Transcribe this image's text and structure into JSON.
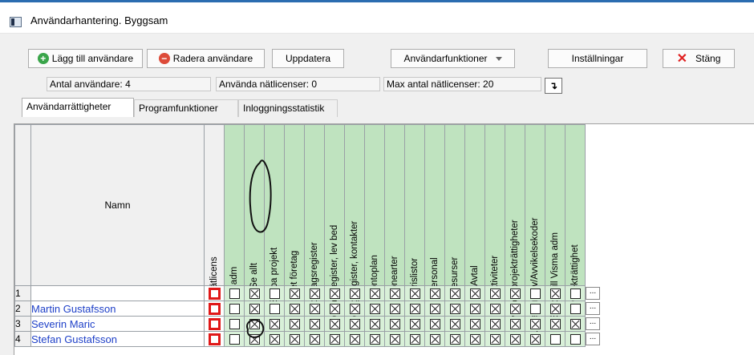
{
  "window": {
    "title": "Användarhantering. Byggsam"
  },
  "toolbar": {
    "add_user": "Lägg till användare",
    "delete_user": "Radera användare",
    "update": "Uppdatera",
    "user_functions": "Användarfunktioner",
    "settings": "Inställningar",
    "close": "Stäng"
  },
  "status": {
    "user_count": "Antal användare: 4",
    "used_licenses": "Använda nätlicenser: 0",
    "max_licenses": "Max antal nätlicenser: 20"
  },
  "tabs": [
    "Användarrättigheter",
    "Programfunktioner",
    "Inloggningsstatistik"
  ],
  "grid": {
    "name_header": "Namn",
    "columns": [
      "Nätlicens",
      "adm",
      "Se allt",
      "Skapa projekt",
      "Eget företag",
      "Företagsregister",
      "Företagsregister, lev bed",
      "Företagsregister, kontakter",
      "Kontoplan",
      "Lönearter",
      "Prislistor",
      "Personal",
      "Resurser",
      "Avtal",
      "Aktiviteter",
      "Omvända projekträttigheter",
      "Listalternativ/Avvikelsekoder",
      "Export till Visma adm",
      "Projekträttighet"
    ],
    "rows": [
      {
        "num": "1",
        "name": "",
        "checks": [
          0,
          1,
          0,
          1,
          1,
          1,
          1,
          1,
          1,
          1,
          1,
          1,
          1,
          1,
          1,
          0,
          1,
          0
        ]
      },
      {
        "num": "2",
        "name": "Martin Gustafsson",
        "checks": [
          0,
          1,
          0,
          1,
          1,
          1,
          1,
          1,
          1,
          1,
          1,
          1,
          1,
          1,
          1,
          0,
          1,
          0
        ]
      },
      {
        "num": "3",
        "name": "Severin Maric",
        "checks": [
          0,
          1,
          1,
          1,
          1,
          1,
          1,
          1,
          1,
          1,
          1,
          1,
          1,
          1,
          1,
          1,
          1,
          1
        ]
      },
      {
        "num": "4",
        "name": "Stefan Gustafsson",
        "checks": [
          0,
          1,
          1,
          1,
          1,
          1,
          1,
          1,
          1,
          1,
          1,
          1,
          1,
          1,
          1,
          1,
          0,
          0
        ]
      }
    ],
    "dots": "..."
  }
}
